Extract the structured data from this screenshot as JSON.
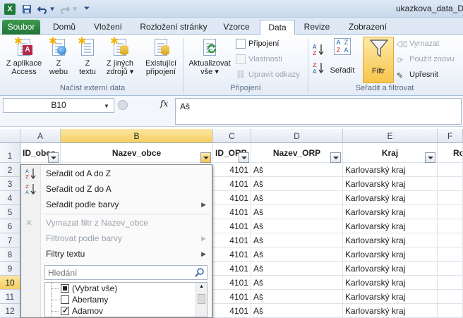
{
  "window": {
    "title": "ukazkova_data_DV"
  },
  "tabs": [
    {
      "label": "Soubor"
    },
    {
      "label": "Domů"
    },
    {
      "label": "Vložení"
    },
    {
      "label": "Rozložení stránky"
    },
    {
      "label": "Vzorce"
    },
    {
      "label": "Data"
    },
    {
      "label": "Revize"
    },
    {
      "label": "Zobrazení"
    }
  ],
  "ribbon": {
    "external": {
      "label": "Načíst externí data",
      "access_1": "Z aplikace",
      "access_2": "Access",
      "web_1": "Z",
      "web_2": "webu",
      "text_1": "Z",
      "text_2": "textu",
      "other_1": "Z jiných",
      "other_2": "zdrojů ▾",
      "existing_1": "Existující",
      "existing_2": "připojení"
    },
    "connections": {
      "label": "Připojení",
      "refresh_1": "Aktualizovat",
      "refresh_2": "vše ▾",
      "connections": "Připojení",
      "properties": "Vlastnosti",
      "edit_links": "Upravit odkazy"
    },
    "sort": {
      "label": "Seřadit a filtrovat",
      "sort": "Seřadit",
      "filter": "Filtr",
      "clear": "Vymazat",
      "reapply": "Použít znovu",
      "advanced": "Upřesnit"
    }
  },
  "formula_bar": {
    "name_box": "B10",
    "fx": "fx",
    "value": "Aš"
  },
  "columns": [
    "A",
    "B",
    "C",
    "D",
    "E",
    "F"
  ],
  "rows": [
    "1",
    "2",
    "3",
    "4",
    "5",
    "6",
    "7",
    "8",
    "9",
    "10",
    "11",
    "12"
  ],
  "headers": {
    "a": "ID_obce",
    "b": "Nazev_obce",
    "c": "ID_ORP",
    "d": "Nazev_ORP",
    "e": "Kraj",
    "f": "Ro"
  },
  "data_rows": [
    {
      "id_orp": "4101",
      "nazev_orp": "Aš",
      "kraj": "Karlovarský kraj"
    },
    {
      "id_orp": "4101",
      "nazev_orp": "Aš",
      "kraj": "Karlovarský kraj"
    },
    {
      "id_orp": "4101",
      "nazev_orp": "Aš",
      "kraj": "Karlovarský kraj"
    },
    {
      "id_orp": "4101",
      "nazev_orp": "Aš",
      "kraj": "Karlovarský kraj"
    },
    {
      "id_orp": "4101",
      "nazev_orp": "Aš",
      "kraj": "Karlovarský kraj"
    },
    {
      "id_orp": "4101",
      "nazev_orp": "Aš",
      "kraj": "Karlovarský kraj"
    },
    {
      "id_orp": "4101",
      "nazev_orp": "Aš",
      "kraj": "Karlovarský kraj"
    },
    {
      "id_orp": "4101",
      "nazev_orp": "Aš",
      "kraj": "Karlovarský kraj"
    },
    {
      "id_orp": "4101",
      "nazev_orp": "Aš",
      "kraj": "Karlovarský kraj"
    },
    {
      "id_orp": "4101",
      "nazev_orp": "Aš",
      "kraj": "Karlovarský kraj"
    },
    {
      "id_orp": "4101",
      "nazev_orp": "Aš",
      "kraj": "Karlovarský kraj"
    }
  ],
  "filter_menu": {
    "sort_az": "Seřadit od A do Z",
    "sort_za": "Seřadit od Z do A",
    "sort_color": "Seřadit podle barvy",
    "clear_filter": "Vymazat filtr z Nazev_obce",
    "filter_color": "Filtrovat podle barvy",
    "text_filters": "Filtry textu",
    "search_placeholder": "Hledání",
    "items": [
      {
        "label": "(Vybrat vše)",
        "state": "partial"
      },
      {
        "label": "Abertamy",
        "state": "unchecked"
      },
      {
        "label": "Adamov",
        "state": "checked"
      }
    ]
  },
  "colors": {
    "file_tab": "#2a8a43",
    "selection": "#f6cf61",
    "accent": "#2a4e86"
  }
}
